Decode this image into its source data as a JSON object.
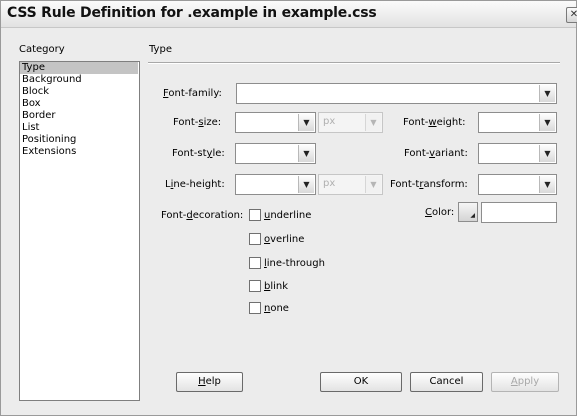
{
  "window": {
    "title": "CSS Rule Definition for .example in example.css",
    "close_glyph": "✕"
  },
  "category": {
    "header": "Category",
    "items": [
      "Type",
      "Background",
      "Block",
      "Box",
      "Border",
      "List",
      "Positioning",
      "Extensions"
    ],
    "selected": "Type"
  },
  "section": {
    "title": "Type"
  },
  "fields": {
    "font_family": {
      "label_u": "F",
      "label_rest": "ont-family:",
      "value": ""
    },
    "font_size": {
      "label_pre": "Font-",
      "label_u": "s",
      "label_rest": "ize:",
      "value": "",
      "unit": "px"
    },
    "font_style": {
      "label_pre": "Font-st",
      "label_u": "y",
      "label_rest": "le:",
      "value": ""
    },
    "line_height": {
      "label_pre": "L",
      "label_u": "i",
      "label_rest": "ne-height:",
      "value": "",
      "unit": "px"
    },
    "font_weight": {
      "label_pre": "Font-",
      "label_u": "w",
      "label_rest": "eight:",
      "value": ""
    },
    "font_variant": {
      "label_pre": "Font-",
      "label_u": "v",
      "label_rest": "ariant:",
      "value": ""
    },
    "font_transform": {
      "label_pre": "Font-t",
      "label_u": "r",
      "label_rest": "ansform:",
      "value": ""
    },
    "color": {
      "label_u": "C",
      "label_rest": "olor:",
      "value": ""
    },
    "decoration": {
      "label_pre": "Font-",
      "label_u": "d",
      "label_rest": "ecoration:"
    }
  },
  "decorations": [
    {
      "u": "u",
      "rest": "nderline",
      "checked": false
    },
    {
      "u": "o",
      "rest": "verline",
      "checked": false
    },
    {
      "u": "l",
      "rest": "ine-through",
      "checked": false
    },
    {
      "u": "b",
      "rest": "link",
      "checked": false
    },
    {
      "u": "n",
      "rest": "one",
      "checked": false
    }
  ],
  "buttons": {
    "help": {
      "u": "H",
      "rest": "elp"
    },
    "ok": "OK",
    "cancel": "Cancel",
    "apply": {
      "u": "A",
      "rest": "pply"
    }
  }
}
